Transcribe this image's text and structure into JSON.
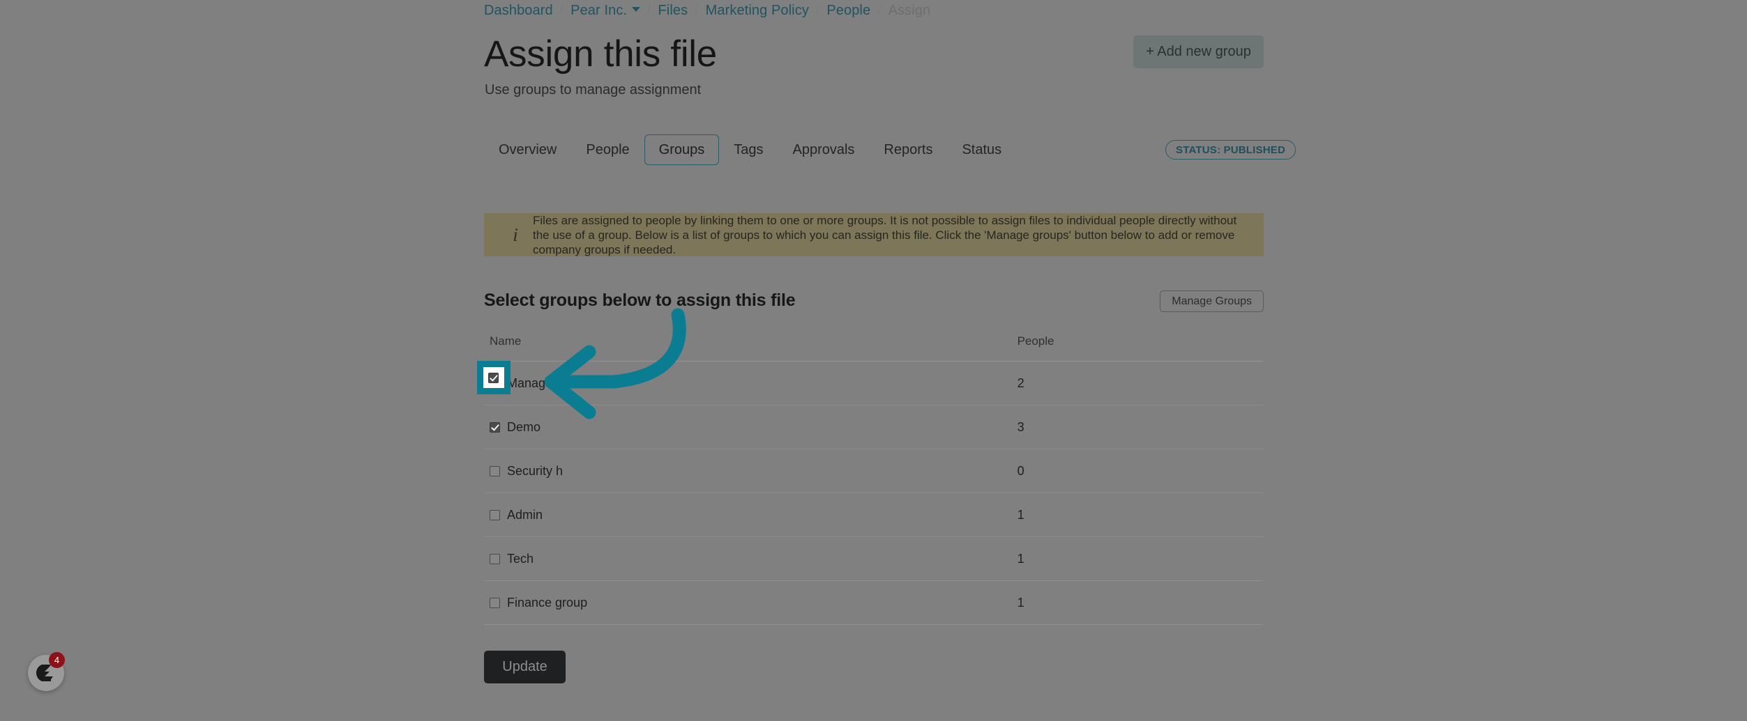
{
  "breadcrumb": {
    "items": [
      {
        "label": "Dashboard",
        "current": false,
        "caret": false
      },
      {
        "label": "Pear Inc.",
        "current": false,
        "caret": true
      },
      {
        "label": "Files",
        "current": false,
        "caret": false
      },
      {
        "label": "Marketing Policy",
        "current": false,
        "caret": false
      },
      {
        "label": "People",
        "current": false,
        "caret": false
      },
      {
        "label": "Assign",
        "current": true,
        "caret": false
      }
    ],
    "separator": "/"
  },
  "header": {
    "title": "Assign this file",
    "subtitle": "Use groups to manage assignment",
    "add_group_label": "+ Add new group"
  },
  "tabs": {
    "items": [
      {
        "label": "Overview",
        "active": false
      },
      {
        "label": "People",
        "active": false
      },
      {
        "label": "Groups",
        "active": true
      },
      {
        "label": "Tags",
        "active": false
      },
      {
        "label": "Approvals",
        "active": false
      },
      {
        "label": "Reports",
        "active": false
      },
      {
        "label": "Status",
        "active": false
      }
    ]
  },
  "status_badge": {
    "label": "STATUS: PUBLISHED",
    "color": "#204f5b"
  },
  "info_banner": {
    "icon": "info-icon",
    "text": "Files are assigned to people by linking them to one or more groups. It is not possible to assign files to individual people directly without the use of a group. Below is a list of groups to which you can assign this file. Click the 'Manage groups' button below to add or remove company groups if needed.",
    "background": "#7e7659"
  },
  "section": {
    "title": "Select groups below to assign this file",
    "manage_groups_label": "Manage Groups"
  },
  "table": {
    "columns": [
      "Name",
      "People"
    ],
    "rows": [
      {
        "name": "Management",
        "people": "2",
        "checked": true,
        "highlighted": true
      },
      {
        "name": "Demo",
        "people": "3",
        "checked": true,
        "highlighted": false
      },
      {
        "name": "Security h",
        "people": "0",
        "checked": false,
        "highlighted": false
      },
      {
        "name": "Admin",
        "people": "1",
        "checked": false,
        "highlighted": false
      },
      {
        "name": "Tech",
        "people": "1",
        "checked": false,
        "highlighted": false
      },
      {
        "name": "Finance group",
        "people": "1",
        "checked": false,
        "highlighted": false
      }
    ]
  },
  "footer": {
    "update_label": "Update"
  },
  "chat_widget": {
    "badge_count": "4",
    "icon": "chat-logo-icon"
  },
  "annotation": {
    "color": "#0b7d92",
    "arrow": "curved-arrow-pointing-left-to-checkbox"
  }
}
